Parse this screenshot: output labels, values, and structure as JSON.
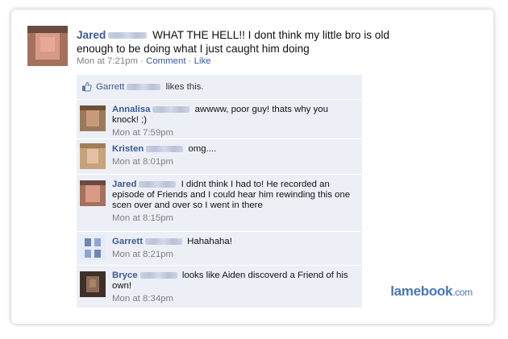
{
  "post": {
    "author": "Jared",
    "text": "WHAT THE HELL!! I dont think my little bro is old enough to be doing what I just caught him doing",
    "time": "Mon at 7:21pm",
    "sep1": " · ",
    "comment_link": "Comment",
    "sep2": " · ",
    "like_link": "Like"
  },
  "likes": {
    "name": "Garrett",
    "suffix": "likes this."
  },
  "comments": [
    {
      "author": "Annalisa",
      "text": "awwww, poor guy! thats why you knock! ;)",
      "time": "Mon at 7:59pm"
    },
    {
      "author": "Kristen",
      "text": "omg....",
      "time": "Mon at 8:01pm"
    },
    {
      "author": "Jared",
      "text": "I didnt think I had to! He recorded an episode of Friends and I could hear him rewinding this one scen over and over so I went in there",
      "time": "Mon at 8:15pm"
    },
    {
      "author": "Garrett",
      "text": "Hahahaha!",
      "time": "Mon at 8:21pm"
    },
    {
      "author": "Bryce",
      "text": "looks like Aiden discoverd a Friend of his own!",
      "time": "Mon at 8:34pm"
    }
  ],
  "watermark": {
    "brand": "lamebook",
    "tld": ".com"
  },
  "colors": {
    "link": "#3b5998",
    "comment_bg": "#eceff5",
    "meta": "#808080"
  }
}
